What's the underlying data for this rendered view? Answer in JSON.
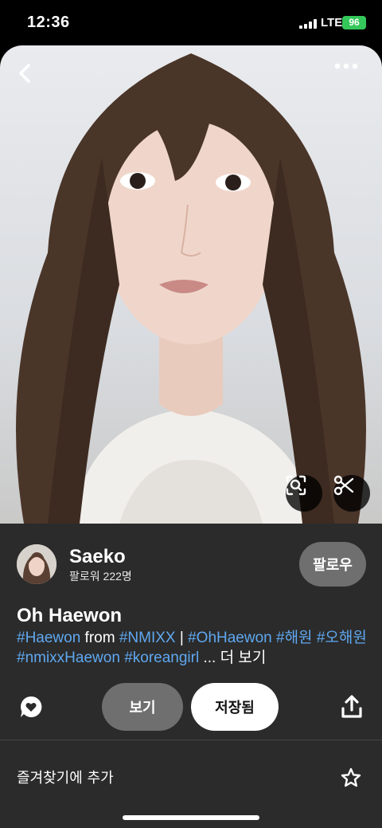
{
  "status_bar": {
    "time": "12:36",
    "network": "LTE",
    "battery": "96"
  },
  "hero": {
    "icons": [
      "back-icon",
      "more-icon",
      "visual-search-icon",
      "scissors-icon"
    ]
  },
  "user": {
    "name": "Saeko",
    "followers": "팔로워 222명",
    "follow_label": "팔로우"
  },
  "pin": {
    "title": "Oh Haewon",
    "desc": {
      "t1": "#Haewon",
      "t2": " from ",
      "t3": "#NMIXX",
      "t4": " | ",
      "t5": "#OhHaewon",
      "t6": " ",
      "t7": "#해원",
      "t8": " ",
      "t9": "#오해원",
      "t10": " ",
      "t11": "#nmixxHaewon",
      "t12": " ",
      "t13": "#koreangirl",
      "t14": " ... 더 보기"
    }
  },
  "actions": {
    "view_label": "보기",
    "saved_label": "저장됨",
    "icons": [
      "comment-icon",
      "share-icon"
    ]
  },
  "favorites": {
    "label": "즐겨찾기에 추가",
    "icon": "star-icon"
  },
  "colors": {
    "tag": "#5fa8f0",
    "panel": "#2b2b2b",
    "battery": "#34c759"
  }
}
